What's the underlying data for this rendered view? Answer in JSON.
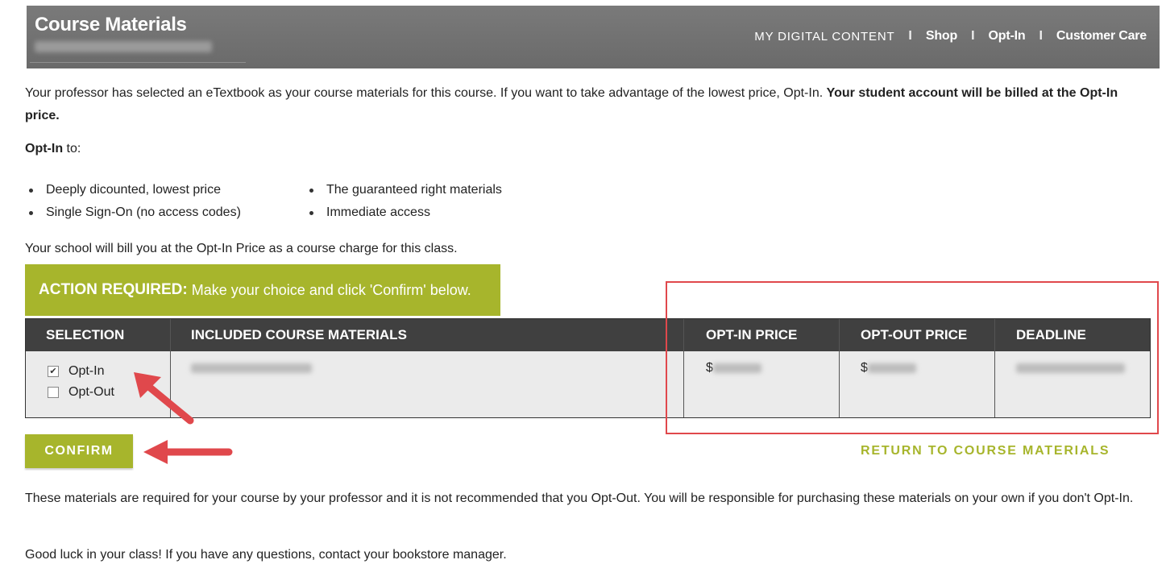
{
  "header": {
    "title": "Course Materials",
    "nav": [
      "MY DIGITAL CONTENT",
      "Shop",
      "Opt-In",
      "Customer Care"
    ],
    "separator": "I"
  },
  "intro": {
    "text": "Your professor has selected an eTextbook as your course materials for this course. If you want to take advantage of the lowest price, Opt-In.",
    "bold": "Your student account will be billed at the Opt-In price."
  },
  "optin_to": {
    "label": "Opt-In",
    "suffix": "to:"
  },
  "bullets": {
    "left": [
      "Deeply dicounted, lowest price",
      "Single Sign-On (no access codes)"
    ],
    "right": [
      "The guaranteed right materials",
      "Immediate access"
    ]
  },
  "school_text": "Your school will bill you at the Opt-In Price as a course charge for this class.",
  "action": {
    "label": "ACTION REQUIRED:",
    "text": "Make your choice and click 'Confirm' below."
  },
  "table": {
    "headers": [
      "SELECTION",
      "INCLUDED COURSE MATERIALS",
      "OPT-IN PRICE",
      "OPT-OUT PRICE",
      "DEADLINE"
    ],
    "row": {
      "options": [
        {
          "label": "Opt-In",
          "checked": true
        },
        {
          "label": "Opt-Out",
          "checked": false
        }
      ],
      "currency": "$"
    }
  },
  "confirm_label": "CONFIRM",
  "return_label": "RETURN TO COURSE MATERIALS",
  "note": "These materials are required for your course by your professor and it is not recommended that you Opt-Out. You will be responsible for purchasing these materials on your own if you don't Opt-In.",
  "closing": "Good luck in your class! If you have any questions, contact your bookstore manager.",
  "colors": {
    "accent": "#a7b52c",
    "header": "#707070",
    "table_header": "#404040",
    "annotation": "#e0484c"
  },
  "icons": [
    "checkbox-checked-icon",
    "checkbox-empty-icon",
    "red-arrow-icon"
  ]
}
